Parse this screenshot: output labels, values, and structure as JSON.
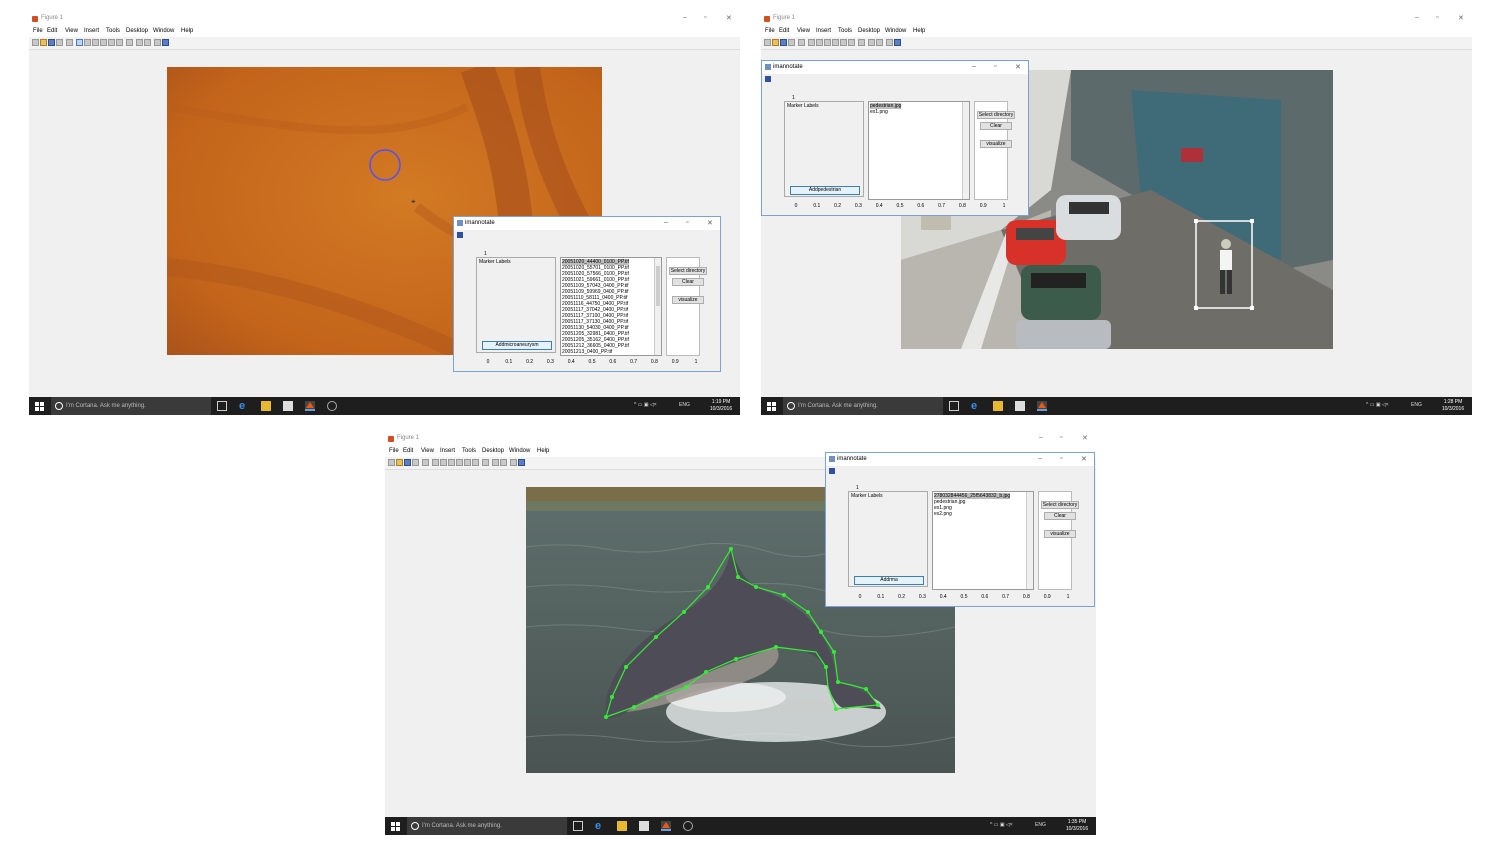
{
  "figure_title": "Figure 1",
  "menu": [
    "File",
    "Edit",
    "View",
    "Insert",
    "Tools",
    "Desktop",
    "Window",
    "Help"
  ],
  "dialog_title": "imannotate",
  "panel_title": "Marker Labels",
  "panel_number": "1",
  "buttons": {
    "select_directory": "Select directory",
    "clear": "Clear",
    "visualize": "visualize"
  },
  "ticks": [
    "0",
    "0.1",
    "0.2",
    "0.3",
    "0.4",
    "0.5",
    "0.6",
    "0.7",
    "0.8",
    "0.9",
    "1"
  ],
  "cortana": "I'm Cortana. Ask me anything.",
  "lang": "ENG",
  "panels": [
    {
      "add_label": "Addmicroaneurysm",
      "files": [
        "20051020_44400_0100_PP.tif",
        "20051020_55701_0100_PP.tif",
        "20051020_57566_0100_PP.tif",
        "20051021_59661_0100_PP.tif",
        "20051109_57043_0400_PP.tif",
        "20051109_59969_0400_PP.tif",
        "20051110_58111_0400_PP.tif",
        "20051116_44750_0400_PP.tif",
        "20051117_37042_0400_PP.tif",
        "20051117_37100_0400_PP.tif",
        "20051117_37130_0400_PP.tif",
        "20051130_54030_0400_PP.tif",
        "20051205_32981_0400_PP.tif",
        "20051205_35162_0400_PP.tif",
        "20051212_36605_0400_PP.tif",
        "20051213_0400_PP.tif"
      ],
      "time": "1:19 PM",
      "date": "10/3/2016"
    },
    {
      "add_label": "Addpedestrian",
      "files": [
        "pedestrian.jpg",
        "ex1.png"
      ],
      "time": "1:28 PM",
      "date": "10/3/2016"
    },
    {
      "add_label": "Addrma",
      "files": [
        "278032844456_25f5643832_b.jpg",
        "pedestrian.jpg",
        "ex1.png",
        "ex2.png"
      ],
      "time": "1:35 PM",
      "date": "10/3/2016"
    }
  ],
  "colors": {
    "taskbar": "#1e1e1e",
    "marker_green": "#33ee33",
    "marker_blue": "#5050ff",
    "retina": "#c8691e"
  }
}
